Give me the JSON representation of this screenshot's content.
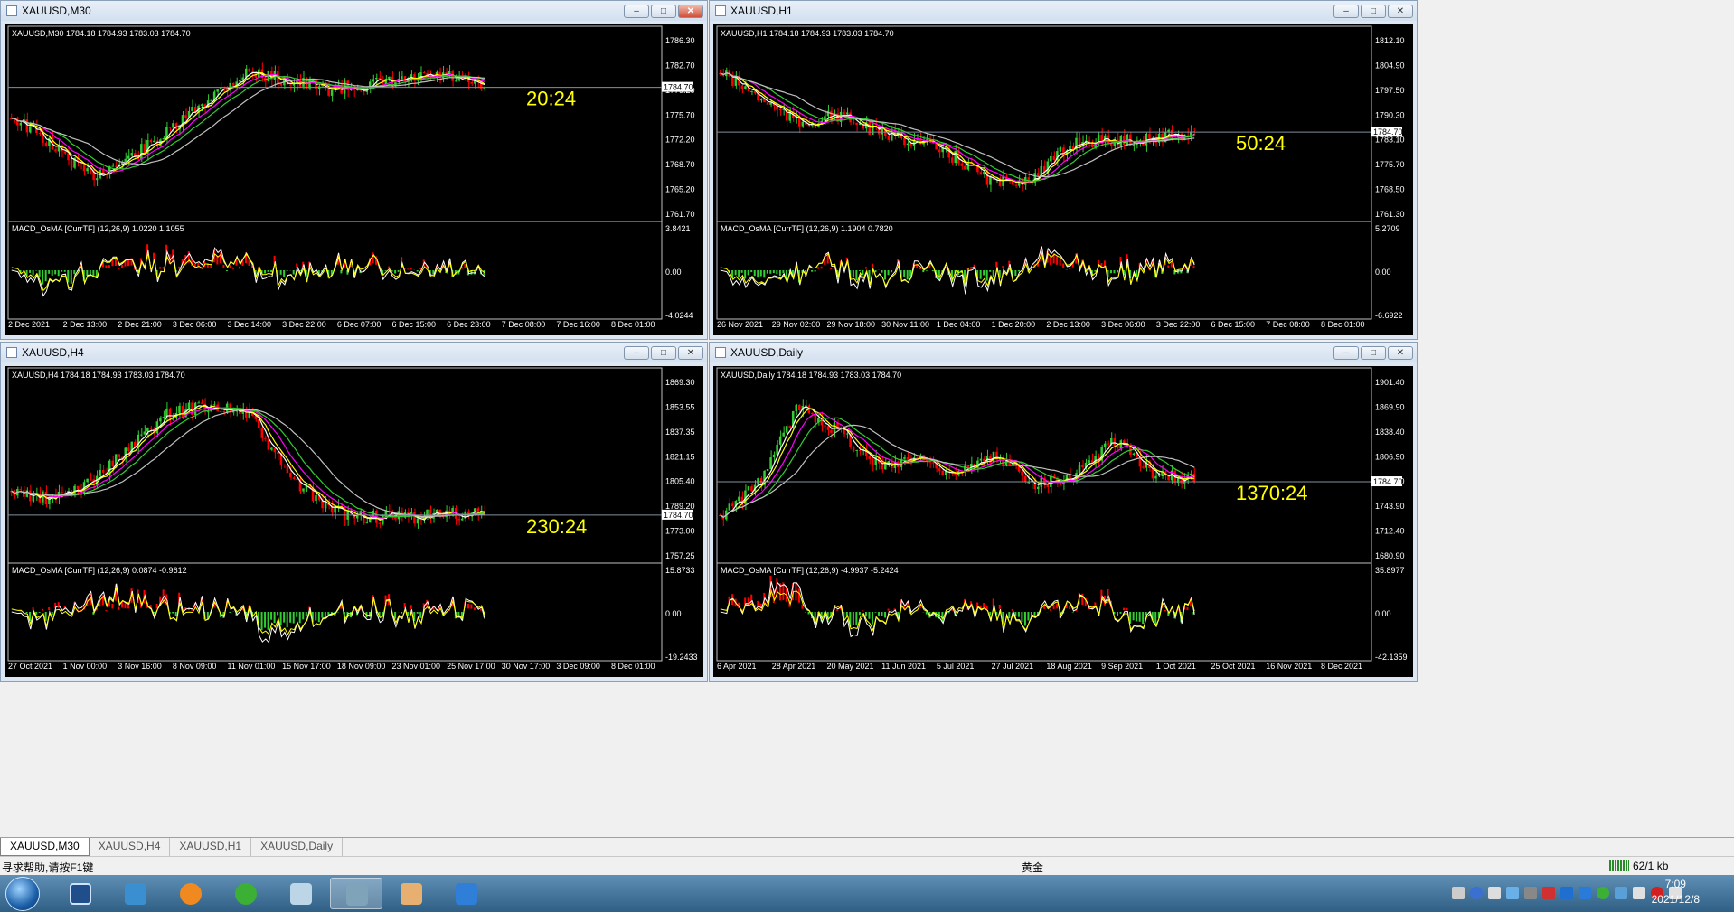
{
  "windows": [
    {
      "title": "XAUUSD,M30",
      "info": "XAUUSD,M30  1784.18 1784.93 1783.03 1784.70",
      "countdown": "20:24",
      "price_ticks": [
        "1786.30",
        "1782.70",
        "1779.20",
        "1775.70",
        "1772.20",
        "1768.70",
        "1765.20",
        "1761.70"
      ],
      "current_price": "1784.70",
      "macd_label": "MACD_OsMA [CurrTF] (12,26,9) 1.0220 1.1055",
      "macd_ticks": [
        "3.8421",
        "0.00",
        "-4.0244"
      ],
      "time_ticks": [
        "2 Dec 2021",
        "2 Dec 13:00",
        "2 Dec 21:00",
        "3 Dec 06:00",
        "3 Dec 14:00",
        "3 Dec 22:00",
        "6 Dec 07:00",
        "6 Dec 15:00",
        "6 Dec 23:00",
        "7 Dec 08:00",
        "7 Dec 16:00",
        "8 Dec 01:00"
      ]
    },
    {
      "title": "XAUUSD,H1",
      "info": "XAUUSD,H1  1784.18 1784.93 1783.03 1784.70",
      "countdown": "50:24",
      "price_ticks": [
        "1812.10",
        "1804.90",
        "1797.50",
        "1790.30",
        "1783.10",
        "1775.70",
        "1768.50",
        "1761.30"
      ],
      "current_price": "1784.70",
      "macd_label": "MACD_OsMA [CurrTF] (12,26,9) 1.1904 0.7820",
      "macd_ticks": [
        "5.2709",
        "0.00",
        "-6.6922"
      ],
      "time_ticks": [
        "26 Nov 2021",
        "29 Nov 02:00",
        "29 Nov 18:00",
        "30 Nov 11:00",
        "1 Dec 04:00",
        "1 Dec 20:00",
        "2 Dec 13:00",
        "3 Dec 06:00",
        "3 Dec 22:00",
        "6 Dec 15:00",
        "7 Dec 08:00",
        "8 Dec 01:00"
      ]
    },
    {
      "title": "XAUUSD,H4",
      "info": "XAUUSD,H4  1784.18 1784.93 1783.03 1784.70",
      "countdown": "230:24",
      "price_ticks": [
        "1869.30",
        "1853.55",
        "1837.35",
        "1821.15",
        "1805.40",
        "1789.20",
        "1773.00",
        "1757.25"
      ],
      "current_price": "1784.70",
      "macd_label": "MACD_OsMA [CurrTF] (12,26,9) 0.0874 -0.9612",
      "macd_ticks": [
        "15.8733",
        "0.00",
        "-19.2433"
      ],
      "time_ticks": [
        "27 Oct 2021",
        "1 Nov 00:00",
        "3 Nov 16:00",
        "8 Nov 09:00",
        "11 Nov 01:00",
        "15 Nov 17:00",
        "18 Nov 09:00",
        "23 Nov 01:00",
        "25 Nov 17:00",
        "30 Nov 17:00",
        "3 Dec 09:00",
        "8 Dec 01:00"
      ]
    },
    {
      "title": "XAUUSD,Daily",
      "info": "XAUUSD,Daily  1784.18 1784.93 1783.03 1784.70",
      "countdown": "1370:24",
      "price_ticks": [
        "1901.40",
        "1869.90",
        "1838.40",
        "1806.90",
        "1775.40",
        "1743.90",
        "1712.40",
        "1680.90"
      ],
      "current_price": "1784.70",
      "macd_label": "MACD_OsMA [CurrTF] (12,26,9) -4.9937 -5.2424",
      "macd_ticks": [
        "35.8977",
        "0.00",
        "-42.1359"
      ],
      "time_ticks": [
        "6 Apr 2021",
        "28 Apr 2021",
        "20 May 2021",
        "11 Jun 2021",
        "5 Jul 2021",
        "27 Jul 2021",
        "18 Aug 2021",
        "9 Sep 2021",
        "1 Oct 2021",
        "25 Oct 2021",
        "16 Nov 2021",
        "8 Dec 2021"
      ]
    }
  ],
  "tabs": [
    "XAUUSD,M30",
    "XAUUSD,H4",
    "XAUUSD,H1",
    "XAUUSD,Daily"
  ],
  "status": {
    "help": "寻求帮助,请按F1键",
    "profile": "黄金",
    "traffic": "62/1 kb"
  },
  "clock": {
    "time": "7:09",
    "date": "2021/12/8"
  },
  "colors": {
    "bull": "#32cd32",
    "bear": "#ff0000",
    "ma1": "#ffffff",
    "ma2": "#ffff00",
    "ma3": "#ff00ff",
    "ma4": "#32cd32",
    "ma5": "#c0c0c0",
    "countdown": "#ffff00"
  },
  "icons": [
    "window-icon",
    "minimize-icon",
    "maximize-icon",
    "close-icon",
    "start-icon",
    "monitor-icon",
    "people-icon",
    "flame-icon",
    "wechat-icon",
    "pen-icon",
    "mt4-icon",
    "paint-icon",
    "note-icon"
  ]
}
